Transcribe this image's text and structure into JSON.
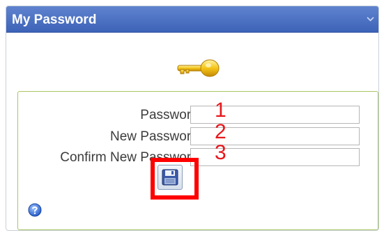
{
  "panel": {
    "title": "My Password"
  },
  "form": {
    "password_label": "Password:",
    "new_password_label": "New Password:",
    "confirm_password_label": "Confirm New Password:",
    "password_value": "",
    "new_password_value": "",
    "confirm_password_value": ""
  },
  "annotations": {
    "marker_1": "1",
    "marker_2": "2",
    "marker_3": "3"
  },
  "icons": {
    "header": "chevron-down-icon",
    "key": "key-icon",
    "save": "floppy-disk-icon",
    "help": "help-icon"
  },
  "colors": {
    "header": "#4a6fc0",
    "group_border": "#a9c463",
    "annotation": "#e8171c",
    "highlight": "#ff0000"
  }
}
